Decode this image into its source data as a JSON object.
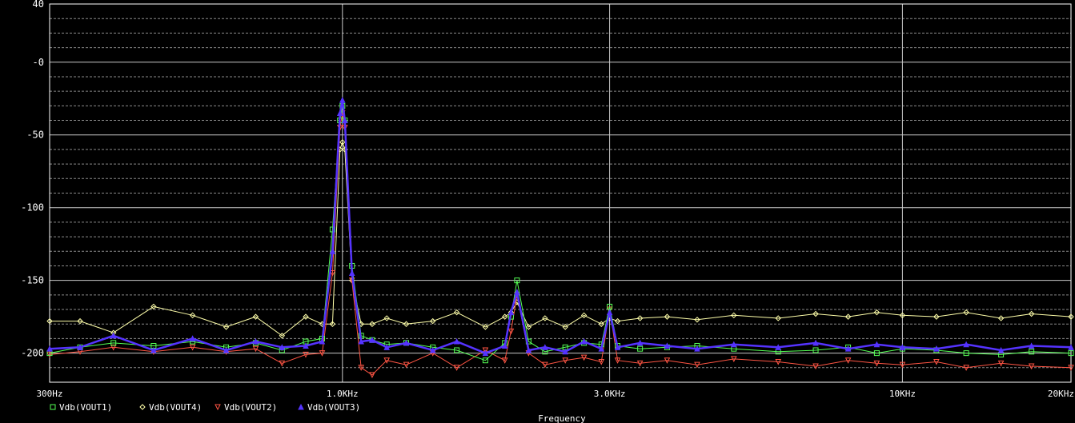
{
  "chart_data": {
    "type": "line",
    "xlabel": "Frequency",
    "ylabel": "",
    "x_scale": "log",
    "xlim": [
      300,
      20000
    ],
    "ylim": [
      -220,
      40
    ],
    "y_ticks": [
      40,
      0,
      -50,
      -100,
      -150,
      -200
    ],
    "y_tick_labels": [
      "40",
      "-0",
      "-50",
      "-100",
      "-150",
      "-200"
    ],
    "x_ticks": [
      300,
      1000,
      3000,
      10000,
      20000
    ],
    "x_tick_labels": [
      "300Hz",
      "1.0KHz",
      "3.0KHz",
      "10KHz",
      "20KHz"
    ],
    "background": "#000000",
    "grid": true,
    "legend_position": "bottom-left",
    "series": [
      {
        "name": "Vdb(VOUT1)",
        "color": "#55ff55",
        "marker": "square",
        "x": [
          300,
          340,
          390,
          460,
          540,
          620,
          700,
          780,
          860,
          920,
          960,
          990,
          1000,
          1010,
          1040,
          1080,
          1130,
          1200,
          1300,
          1450,
          1600,
          1800,
          1950,
          2000,
          2050,
          2150,
          2300,
          2500,
          2700,
          2900,
          3000,
          3100,
          3400,
          3800,
          4300,
          5000,
          6000,
          7000,
          8000,
          9000,
          10000,
          11500,
          13000,
          15000,
          17000,
          20000
        ],
        "y": [
          -200,
          -196,
          -193,
          -195,
          -192,
          -196,
          -193,
          -198,
          -192,
          -190,
          -115,
          -40,
          -30,
          -40,
          -140,
          -188,
          -191,
          -194,
          -193,
          -196,
          -198,
          -205,
          -193,
          -175,
          -150,
          -192,
          -199,
          -196,
          -193,
          -194,
          -168,
          -195,
          -197,
          -196,
          -195,
          -197,
          -199,
          -198,
          -196,
          -200,
          -197,
          -198,
          -200,
          -201,
          -199,
          -200
        ]
      },
      {
        "name": "Vdb(VOUT4)",
        "color": "#ffffaa",
        "marker": "diamond",
        "x": [
          300,
          340,
          390,
          460,
          540,
          620,
          700,
          780,
          860,
          920,
          960,
          990,
          1000,
          1010,
          1040,
          1080,
          1130,
          1200,
          1300,
          1450,
          1600,
          1800,
          1950,
          2000,
          2050,
          2150,
          2300,
          2500,
          2700,
          2900,
          3000,
          3100,
          3400,
          3800,
          4300,
          5000,
          6000,
          7000,
          8000,
          9000,
          10000,
          11500,
          13000,
          15000,
          17000,
          20000
        ],
        "y": [
          -178,
          -178,
          -186,
          -168,
          -174,
          -182,
          -175,
          -188,
          -175,
          -180,
          -180,
          -60,
          -55,
          -60,
          -150,
          -180,
          -180,
          -176,
          -180,
          -178,
          -172,
          -182,
          -175,
          -172,
          -165,
          -182,
          -176,
          -182,
          -174,
          -180,
          -176,
          -178,
          -176,
          -175,
          -177,
          -174,
          -176,
          -173,
          -175,
          -172,
          -174,
          -175,
          -172,
          -176,
          -173,
          -175
        ]
      },
      {
        "name": "Vdb(VOUT2)",
        "color": "#ff5544",
        "marker": "triangle-down",
        "x": [
          300,
          340,
          390,
          460,
          540,
          620,
          700,
          780,
          860,
          920,
          960,
          990,
          1000,
          1010,
          1040,
          1080,
          1130,
          1200,
          1300,
          1450,
          1600,
          1800,
          1950,
          2000,
          2050,
          2150,
          2300,
          2500,
          2700,
          2900,
          3000,
          3100,
          3400,
          3800,
          4300,
          5000,
          6000,
          7000,
          8000,
          9000,
          10000,
          11500,
          13000,
          15000,
          17000,
          20000
        ],
        "y": [
          -201,
          -199,
          -196,
          -199,
          -196,
          -199,
          -197,
          -207,
          -201,
          -200,
          -145,
          -45,
          -35,
          -45,
          -150,
          -210,
          -215,
          -205,
          -208,
          -200,
          -210,
          -198,
          -205,
          -185,
          -160,
          -200,
          -208,
          -205,
          -203,
          -206,
          -170,
          -205,
          -207,
          -205,
          -208,
          -204,
          -206,
          -209,
          -205,
          -207,
          -208,
          -206,
          -210,
          -207,
          -209,
          -210
        ]
      },
      {
        "name": "Vdb(VOUT3)",
        "color": "#5533ff",
        "marker": "triangle-up",
        "x": [
          300,
          340,
          390,
          460,
          540,
          620,
          700,
          780,
          860,
          920,
          960,
          990,
          1000,
          1010,
          1040,
          1080,
          1130,
          1200,
          1300,
          1450,
          1600,
          1800,
          1950,
          2000,
          2050,
          2150,
          2300,
          2500,
          2700,
          2900,
          3000,
          3100,
          3400,
          3800,
          4300,
          5000,
          6000,
          7000,
          8000,
          9000,
          10000,
          11500,
          13000,
          15000,
          17000,
          20000
        ],
        "y": [
          -197,
          -196,
          -188,
          -198,
          -190,
          -198,
          -192,
          -196,
          -195,
          -192,
          -130,
          -35,
          -26,
          -40,
          -145,
          -192,
          -191,
          -196,
          -193,
          -198,
          -192,
          -200,
          -195,
          -172,
          -158,
          -198,
          -196,
          -199,
          -192,
          -197,
          -172,
          -196,
          -193,
          -195,
          -197,
          -194,
          -196,
          -193,
          -197,
          -194,
          -196,
          -197,
          -194,
          -198,
          -195,
          -196
        ]
      }
    ]
  }
}
